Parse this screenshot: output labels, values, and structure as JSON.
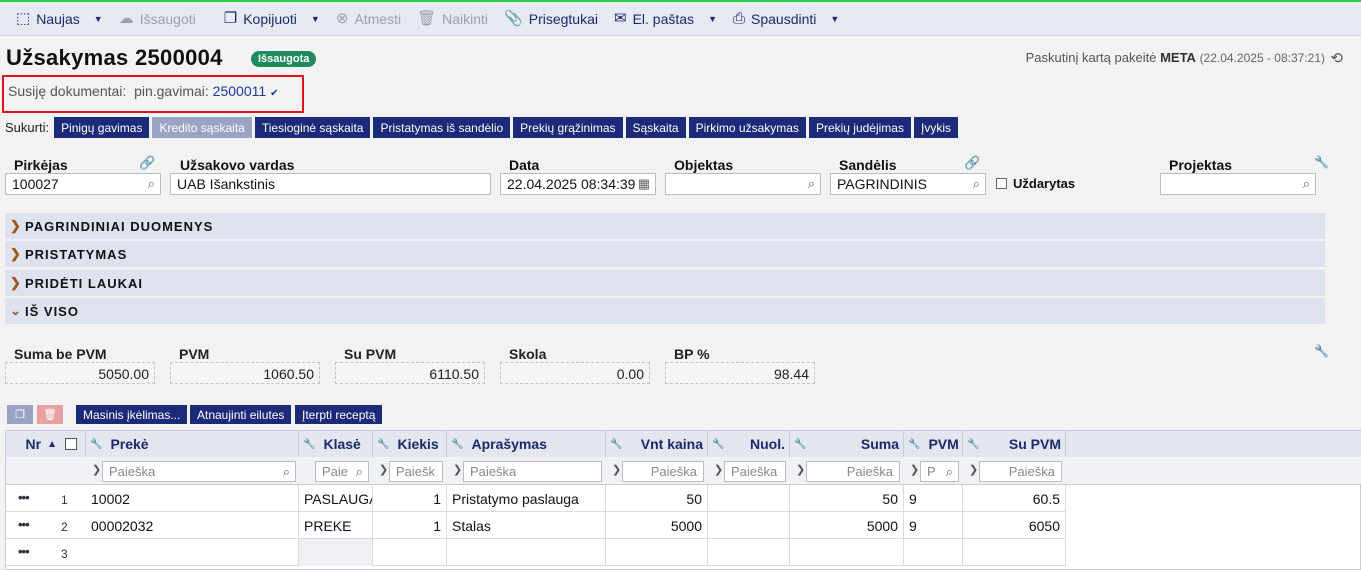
{
  "toolbar": {
    "new": "Naujas",
    "save": "Išsaugoti",
    "copy": "Kopijuoti",
    "cancel": "Atmesti",
    "delete": "Naikinti",
    "attachments": "Prisegtukai",
    "email": "El. paštas",
    "print": "Spausdinti"
  },
  "header": {
    "title": "Užsakymas 2500004",
    "status": "Išsaugota",
    "last_modified_label": "Paskutinį kartą pakeitė",
    "last_modified_user": "META",
    "last_modified_time": "(22.04.2025 - 08:37:21)"
  },
  "related": {
    "label": "Susiję dokumentai:",
    "type": "pin.gavimai:",
    "doc": "2500011"
  },
  "create": {
    "label": "Sukurti:",
    "buttons": [
      "Pinigų gavimas",
      "Kredito sąskaita",
      "Tiesioginė sąskaita",
      "Pristatymas iš sandėlio",
      "Prekių grąžinimas",
      "Sąskaita",
      "Pirkimo užsakymas",
      "Prekių judėjimas",
      "Įvykis"
    ]
  },
  "fields": {
    "buyer_label": "Pirkėjas",
    "buyer_value": "100027",
    "customer_name_label": "Užsakovo vardas",
    "customer_name_value": "UAB Išankstinis",
    "date_label": "Data",
    "date_value": "22.04.2025 08:34:39",
    "object_label": "Objektas",
    "object_value": "",
    "warehouse_label": "Sandėlis",
    "warehouse_value": "PAGRINDINIS",
    "closed_label": "Uždarytas",
    "project_label": "Projektas",
    "project_value": ""
  },
  "sections": [
    "PAGRINDINIAI DUOMENYS",
    "PRISTATYMAS",
    "PRIDĖTI LAUKAI",
    "IŠ VISO"
  ],
  "totals": {
    "labels": [
      "Suma be PVM",
      "PVM",
      "Su PVM",
      "Skola",
      "BP %"
    ],
    "values": [
      "5050.00",
      "1060.50",
      "6110.50",
      "0.00",
      "98.44"
    ]
  },
  "grid_toolbar": {
    "mass_insert": "Masinis įkėlimas...",
    "refresh_rows": "Atnaujinti eilutes",
    "insert_recipe": "Įterpti receptą"
  },
  "grid": {
    "headers": [
      "Nr",
      "Prekė",
      "Klasė",
      "Kiekis",
      "Aprašymas",
      "Vnt kaina",
      "Nuol.",
      "Suma",
      "PVM",
      "Su PVM"
    ],
    "filter_placeholders": [
      "Paieška",
      "Paie",
      "Paiešk",
      "Paieška",
      "Paieška",
      "Paieška",
      "Paieška",
      "P",
      "Paieška"
    ],
    "rows": [
      {
        "nr": "1",
        "item": "10002",
        "class": "PASLAUGA",
        "qty": "1",
        "desc": "Pristatymo paslauga",
        "price": "50",
        "disc": "",
        "sum": "50",
        "vat": "9",
        "total": "60.5"
      },
      {
        "nr": "2",
        "item": "00002032",
        "class": "PREKE",
        "qty": "1",
        "desc": "Stalas",
        "price": "5000",
        "disc": "",
        "sum": "5000",
        "vat": "9",
        "total": "6050"
      },
      {
        "nr": "3",
        "item": "",
        "class": "",
        "qty": "",
        "desc": "",
        "price": "",
        "disc": "",
        "sum": "",
        "vat": "",
        "total": ""
      }
    ]
  },
  "colors": {
    "accent": "#1c2a7a",
    "status_green": "#1f8a5b",
    "highlight_red": "#e0101a",
    "top_border": "#2ecc40"
  }
}
